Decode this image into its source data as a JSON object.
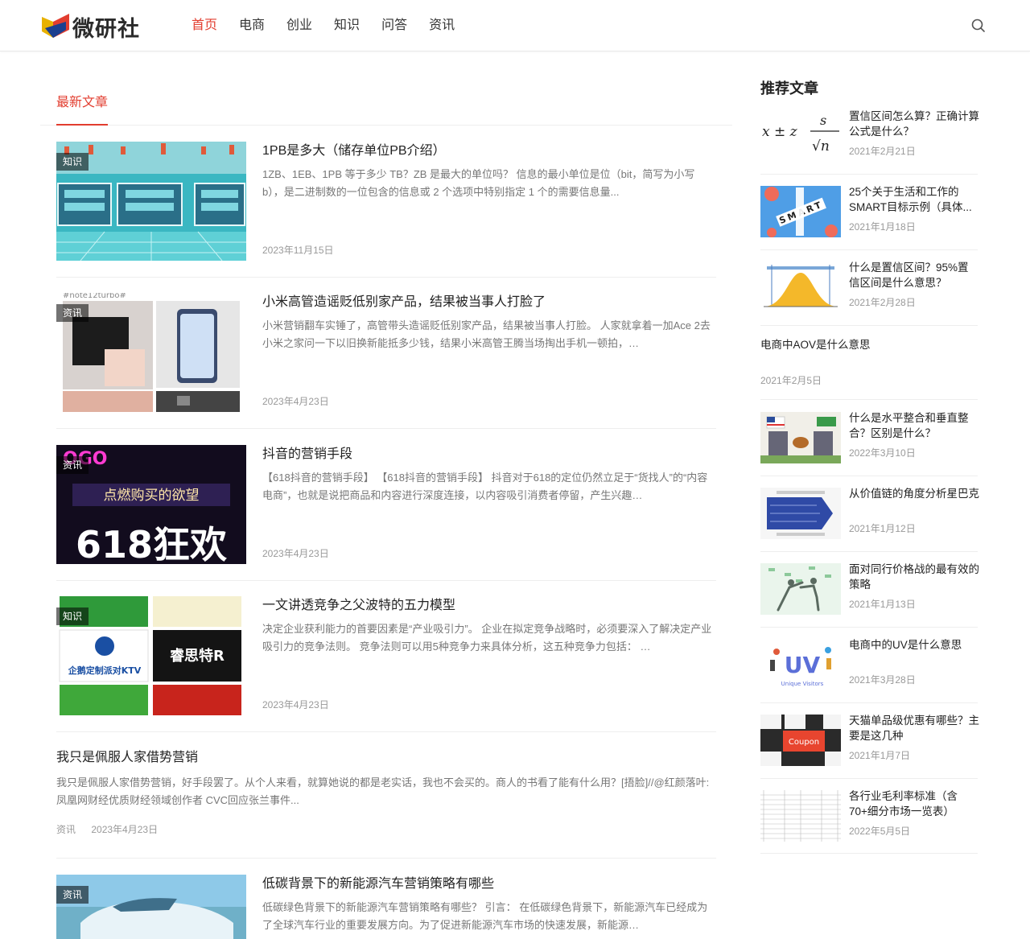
{
  "header": {
    "logo_text": "微研社",
    "nav": [
      "首页",
      "电商",
      "创业",
      "知识",
      "问答",
      "资讯"
    ],
    "active_nav": "首页",
    "search_icon": "search-icon",
    "accent_color": "#e23d2f"
  },
  "main": {
    "tab_label": "最新文章",
    "articles": [
      {
        "badge": "知识",
        "title": "1PB是多大（储存单位PB介绍）",
        "excerpt": "1ZB、1EB、1PB 等于多少 TB？ZB 是最大的单位吗？ 信息的最小单位是位（bit，简写为小写 b），是二进制数的一位包含的信息或 2 个选项中特别指定 1 个的需要信息量...",
        "date": "2023年11月15日"
      },
      {
        "badge": "资讯",
        "title": "小米高管造谣贬低别家产品，结果被当事人打脸了",
        "excerpt": "小米营销翻车实锤了，高管带头造谣贬低别家产品，结果被当事人打脸。 人家就拿着一加Ace 2去小米之家问一下以旧换新能抵多少钱，结果小米高管王腾当场掏出手机一顿拍，…",
        "date": "2023年4月23日"
      },
      {
        "badge": "资讯",
        "title": "抖音的营销手段",
        "excerpt": "【618抖音的营销手段】 【618抖音的营销手段】 抖音对于618的定位仍然立足于“货找人”的“内容电商”，也就是说把商品和内容进行深度连接，以内容吸引消费者停留，产生兴趣…",
        "date": "2023年4月23日"
      },
      {
        "badge": "知识",
        "title": "一文讲透竞争之父波特的五力模型",
        "excerpt": "决定企业获利能力的首要因素是“产业吸引力”。 企业在拟定竞争战略时，必须要深入了解决定产业吸引力的竞争法则。 竞争法则可以用5种竞争力来具体分析，这五种竞争力包括： …",
        "date": "2023年4月23日"
      }
    ],
    "text_article": {
      "title": "我只是佩服人家借势营销",
      "excerpt": "我只是佩服人家借势营销，好手段罢了。从个人来看，就算她说的都是老实话，我也不会买的。商人的书看了能有什么用？[捂脸]//@红颜落叶:凤凰网财经优质财经领域创作者 CVC回应张兰事件...",
      "category": "资讯",
      "date": "2023年4月23日"
    },
    "last_article": {
      "badge": "资讯",
      "title": "低碳背景下的新能源汽车营销策略有哪些",
      "excerpt": "低碳绿色背景下的新能源汽车营销策略有哪些？ 引言： 在低碳绿色背景下，新能源汽车已经成为了全球汽车行业的重要发展方向。为了促进新能源汽车市场的快速发展，新能源…"
    }
  },
  "sidebar": {
    "title": "推荐文章",
    "items": [
      {
        "title": "置信区间怎么算？正确计算公式是什么？",
        "date": "2021年2月21日"
      },
      {
        "title": "25个关于生活和工作的SMART目标示例（具体...",
        "date": "2021年1月18日"
      },
      {
        "title": "什么是置信区间？95%置信区间是什么意思？",
        "date": "2021年2月28日"
      },
      {
        "title": "电商中AOV是什么意思",
        "date": "2021年2月5日"
      },
      {
        "title": "什么是水平整合和垂直整合？区别是什么？",
        "date": "2022年3月10日"
      },
      {
        "title": "从价值链的角度分析星巴克",
        "date": "2021年1月12日"
      },
      {
        "title": "面对同行价格战的最有效的策略",
        "date": "2021年1月13日"
      },
      {
        "title": "电商中的UV是什么意思",
        "date": "2021年3月28日"
      },
      {
        "title": "天猫单品级优惠有哪些？主要是这几种",
        "date": "2021年1月7日"
      },
      {
        "title": "各行业毛利率标准（含70+细分市场一览表）",
        "date": "2022年5月5日"
      }
    ],
    "thumb_texts": {
      "formula_s": "s",
      "formula_main": "x ± z",
      "formula_n": "√n",
      "smart_letters": "SMART",
      "uv_text": "UV",
      "uv_caption": "Unique Visitors",
      "coupon_text": "Coupon"
    }
  },
  "thumb_texts": {
    "a3_top": "OGO",
    "a3_mid": "点燃购买的欲望",
    "a3_big": "618狂欢",
    "a2_top": "#note12turbo#",
    "a4_ktv": "企鹅定制派对KTV",
    "a4_brand": "睿思特R"
  }
}
